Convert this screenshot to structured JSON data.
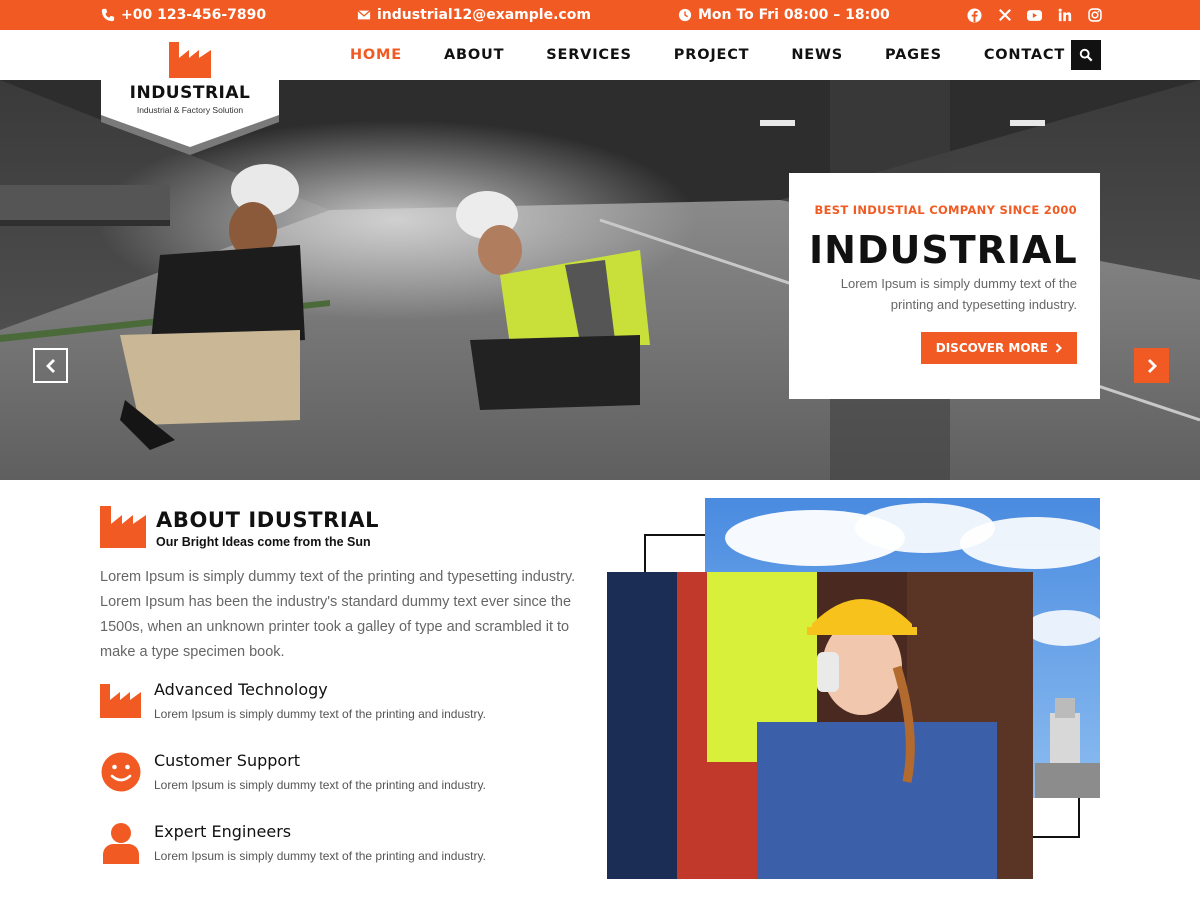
{
  "topbar": {
    "phone": "+00 123-456-7890",
    "email": "industrial12@example.com",
    "hours": "Mon To Fri 08:00 – 18:00",
    "socials": [
      "facebook-icon",
      "x-icon",
      "youtube-icon",
      "linkedin-icon",
      "instagram-icon"
    ]
  },
  "logo": {
    "name": "INDUSTRIAL",
    "tagline": "Industrial & Factory Solution"
  },
  "nav": {
    "items": [
      {
        "label": "HOME",
        "active": true
      },
      {
        "label": "ABOUT",
        "active": false
      },
      {
        "label": "SERVICES",
        "active": false
      },
      {
        "label": "PROJECT",
        "active": false
      },
      {
        "label": "NEWS",
        "active": false
      },
      {
        "label": "PAGES",
        "active": false
      },
      {
        "label": "CONTACT",
        "active": false
      }
    ],
    "search_icon": "search-icon"
  },
  "hero": {
    "kicker": "BEST INDUSTIAL COMPANY SINCE 2000",
    "title": "INDUSTRIAL",
    "description": "Lorem Ipsum is simply dummy text of the printing and typesetting industry.",
    "button": "DISCOVER MORE"
  },
  "about": {
    "title": "ABOUT IDUSTRIAL",
    "subtitle": "Our Bright Ideas come from the Sun",
    "text": "Lorem Ipsum is simply dummy text of the printing and typesetting industry. Lorem Ipsum has been the industry's standard dummy text ever since the 1500s, when an unknown printer took a galley of type and scrambled it to make a type specimen book.",
    "features": [
      {
        "title": "Advanced Technology",
        "desc": "Lorem Ipsum is simply dummy text of the printing and  industry.",
        "icon": "factory-icon"
      },
      {
        "title": "Customer Support",
        "desc": "Lorem Ipsum is simply dummy text of the printing and  industry.",
        "icon": "smile-icon"
      },
      {
        "title": "Expert Engineers",
        "desc": "Lorem Ipsum is simply dummy text of the printing and  industry.",
        "icon": "user-icon"
      }
    ]
  },
  "colors": {
    "accent": "#f15a22",
    "dark": "#111111",
    "text_muted": "#666666"
  }
}
